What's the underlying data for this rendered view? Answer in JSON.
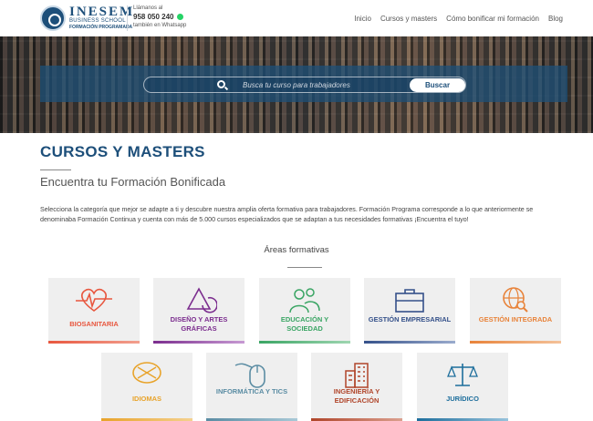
{
  "header": {
    "logo_name": "INESEM",
    "logo_sub": "BUSINESS SCHOOL",
    "logo_sub2": "FORMACIÓN PROGRAMADA",
    "call_label": "Llámanos al",
    "phone": "958 050 240",
    "whatsapp_label": "también en Whatsapp",
    "nav": [
      "Inicio",
      "Cursos y masters",
      "Cómo bonificar mi formación",
      "Blog"
    ]
  },
  "search": {
    "placeholder": "Busca tu curso para trabajadores",
    "button_label": "Buscar"
  },
  "main": {
    "title": "CURSOS Y MASTERS",
    "subtitle": "Encuentra tu Formación Bonificada",
    "intro": "Selecciona la categoría que mejor se adapte a ti y descubre nuestra amplia oferta formativa para trabajadores. Formación Programa corresponde a lo que anteriormente se denominaba Formación Continua y cuenta con más de 5.000 cursos especializados que se adaptan a tus necesidades formativas ¡Encuentra el tuyo!",
    "areas_heading": "Áreas formativas"
  },
  "areas": [
    {
      "label": "BIOSANITARIA",
      "color": "#e8573f",
      "icon": "heartbeat-icon"
    },
    {
      "label": "DISEÑO Y ARTES GRÁFICAS",
      "color": "#7b2d8e",
      "icon": "shapes-icon"
    },
    {
      "label": "EDUCACIÓN Y SOCIEDAD",
      "color": "#3aa564",
      "icon": "people-icon"
    },
    {
      "label": "GESTIÓN EMPRESARIAL",
      "color": "#35518a",
      "icon": "briefcase-icon"
    },
    {
      "label": "GESTIÓN INTEGRADA",
      "color": "#e8833a",
      "icon": "globe-search-icon"
    },
    {
      "label": "IDIOMAS",
      "color": "#e8a32a",
      "icon": "speech-bubble-icon"
    },
    {
      "label": "INFORMÁTICA Y TICS",
      "color": "#5a8ca3",
      "icon": "mouse-icon"
    },
    {
      "label": "INGENIERÍA Y EDIFICACIÓN",
      "color": "#b0452a",
      "icon": "building-icon"
    },
    {
      "label": "JURÍDICO",
      "color": "#1d6e9c",
      "icon": "scales-icon"
    }
  ]
}
